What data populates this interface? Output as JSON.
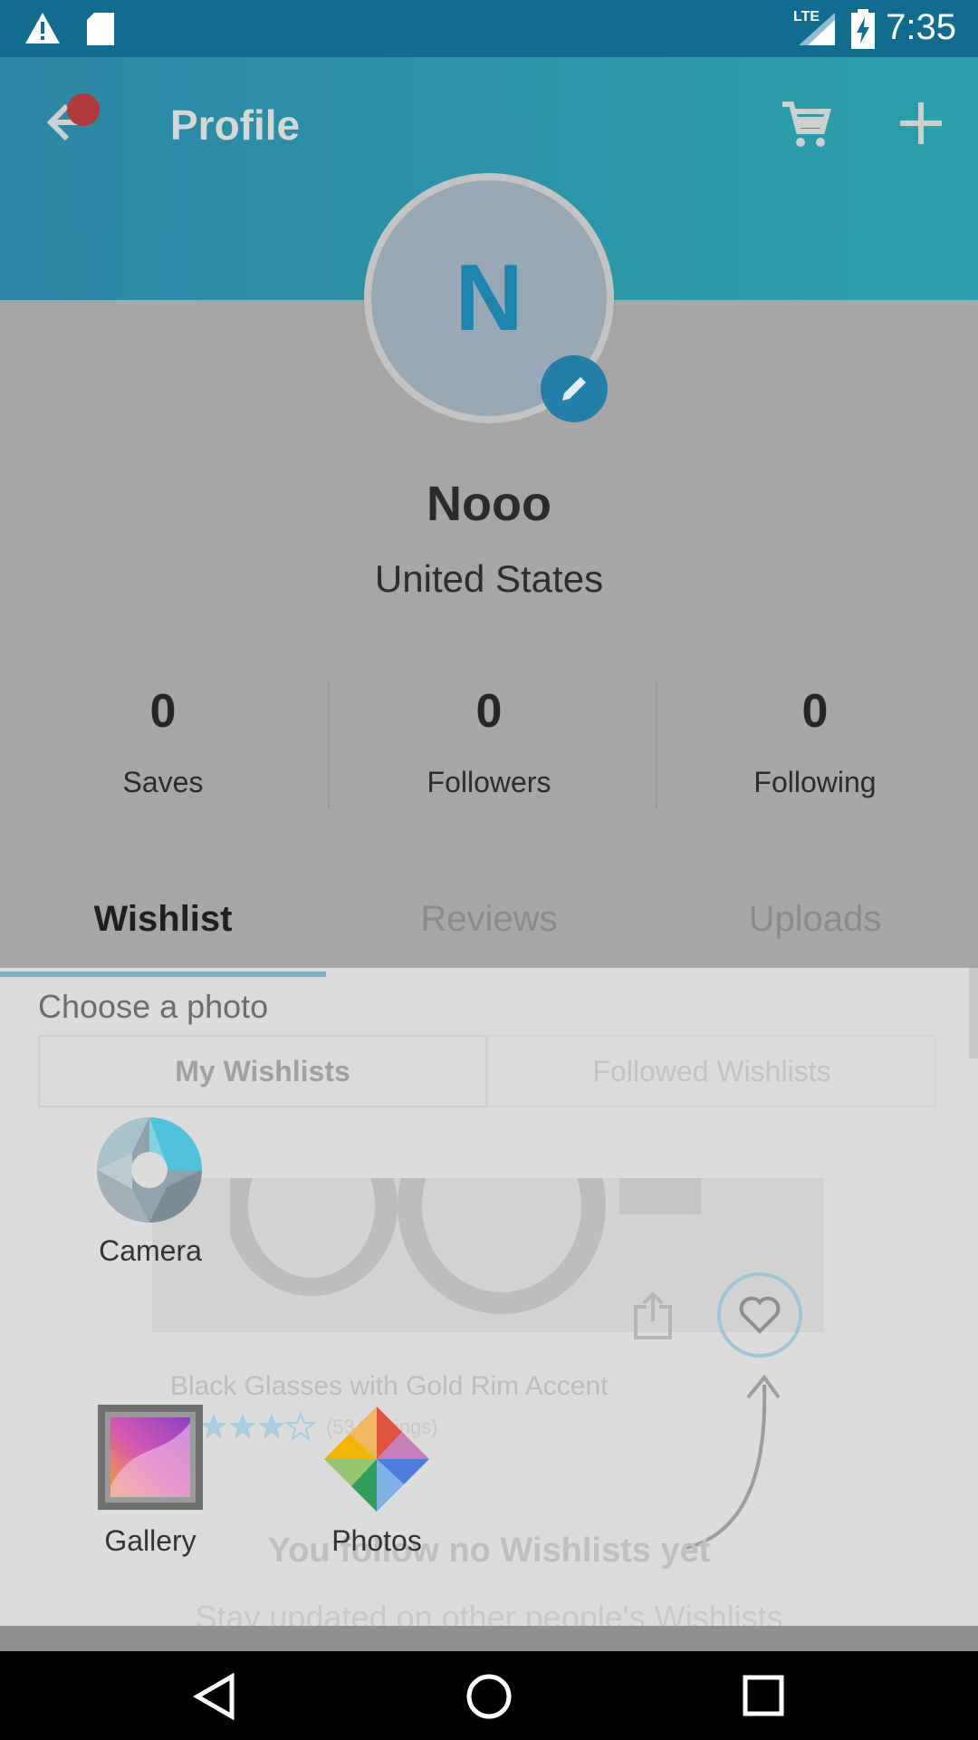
{
  "status_bar": {
    "time": "7:35",
    "network": "LTE"
  },
  "app_bar": {
    "title": "Profile"
  },
  "profile": {
    "initial": "N",
    "name": "Nooo",
    "country": "United States"
  },
  "stats": [
    {
      "value": "0",
      "label": "Saves"
    },
    {
      "value": "0",
      "label": "Followers"
    },
    {
      "value": "0",
      "label": "Following"
    }
  ],
  "tabs": [
    {
      "label": "Wishlist"
    },
    {
      "label": "Reviews"
    },
    {
      "label": "Uploads"
    }
  ],
  "chooser": {
    "title": "Choose a photo",
    "apps": [
      {
        "label": "Camera"
      },
      {
        "label": "Gallery"
      },
      {
        "label": "Photos"
      }
    ]
  },
  "wishlist": {
    "segments": {
      "left": "My Wishlists",
      "right": "Followed Wishlists"
    },
    "product_title": "Black Glasses with Gold Rim Accent",
    "rating_text": "(534 ratings)",
    "empty_title": "You follow no Wishlists yet",
    "empty_subtitle": "Stay updated on other people's Wishlists"
  },
  "colors": {
    "accent": "#237fa8",
    "status_bar": "#116c8f"
  }
}
